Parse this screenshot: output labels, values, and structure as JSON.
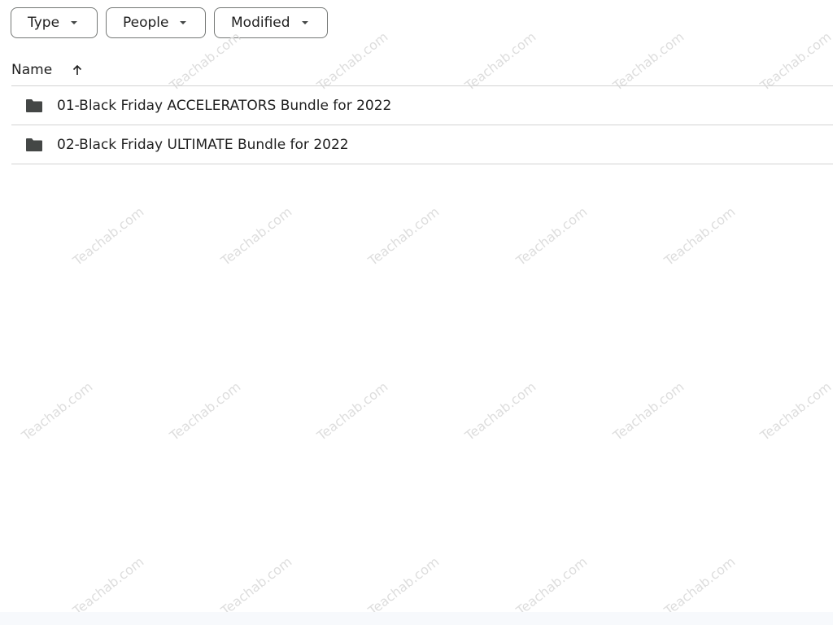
{
  "filters": {
    "type_label": "Type",
    "people_label": "People",
    "modified_label": "Modified"
  },
  "list_header": {
    "name_label": "Name",
    "sort_icon": "arrow-up-icon"
  },
  "items": [
    {
      "name": "01-Black Friday ACCELERATORS Bundle for 2022",
      "icon": "folder-icon"
    },
    {
      "name": "02-Black Friday ULTIMATE Bundle for 2022",
      "icon": "folder-icon"
    }
  ],
  "watermark": {
    "text": "Teachab.com"
  },
  "colors": {
    "folder": "#444746",
    "border": "#747775",
    "divider": "#d3d3d3",
    "text": "#1f1f1f",
    "watermark": "#d8d8d8"
  }
}
